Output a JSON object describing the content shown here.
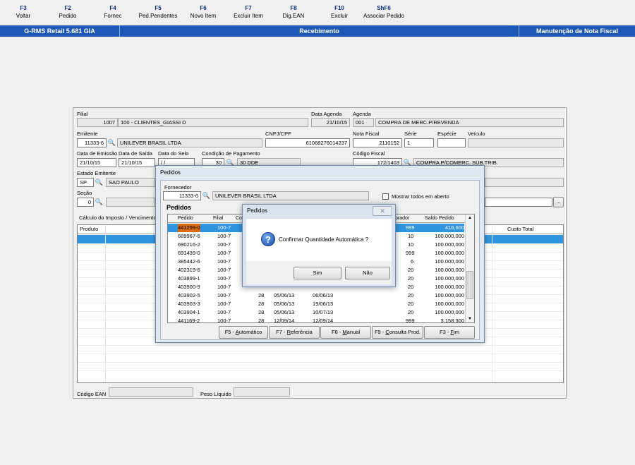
{
  "fkeys": [
    {
      "key": "F3",
      "label": "Voltar"
    },
    {
      "key": "F2",
      "label": "Pedido"
    },
    {
      "key": "F4",
      "label": "Fornec"
    },
    {
      "key": "F5",
      "label": "Ped.Pendentes"
    },
    {
      "key": "F6",
      "label": "Novo Item"
    },
    {
      "key": "F7",
      "label": "Excluir Item"
    },
    {
      "key": "F8",
      "label": "Dig.EAN"
    },
    {
      "key": "F10",
      "label": "Excluir"
    },
    {
      "key": "ShF6",
      "label": "Associar Pedido"
    }
  ],
  "titlebar": {
    "app": "G-RMS Retail 5.681 GIA",
    "center": "Recebimento",
    "right": "Manutenção de Nota Fiscal"
  },
  "form": {
    "filial_label": "Filial",
    "filial_code": "1007",
    "filial_name": "100 - CLIENTES_GIASSI D",
    "data_agenda_label": "Data Agenda",
    "data_agenda": "21/10/15",
    "agenda_label": "Agenda",
    "agenda_code": "001",
    "agenda_desc": "COMPRA DE MERC.P/REVENDA",
    "emitente_label": "Emitente",
    "emitente_code": "11333-6",
    "emitente_name": "UNILEVER BRASIL LTDA",
    "cnpj_label": "CNPJ/CPF",
    "cnpj": "61068276014237",
    "nota_label": "Nota Fiscal",
    "nota": "2110152",
    "serie_label": "Série",
    "serie": "1",
    "especie_label": "Espécie",
    "especie": "",
    "veiculo_label": "Veículo",
    "veiculo": "",
    "data_emissao_label": "Data de Emissão",
    "data_emissao": "21/10/15",
    "data_saida_label": "Data de Saída",
    "data_saida": "21/10/15",
    "data_selo_label": "Data do Selo",
    "data_selo": " /  /",
    "cond_pag_label": "Condição de Pagamento",
    "cond_pag_code": "30",
    "cond_pag_desc": "30 DDE",
    "cod_fiscal_label": "Código Fiscal",
    "cod_fiscal": "172/1403",
    "cod_fiscal_desc": "COMPRA P/COMERC. SUB.TRIB.",
    "estado_label": "Estado Emitente",
    "estado": "SP",
    "estado_name": "SAO PAULO",
    "secao_label": "Seção",
    "secao": "0",
    "ellipsis": "...",
    "calc_label": "Cálculo do Imposto / Vencimento",
    "grid_col_produto": "Produto",
    "grid_col_custo": "Custo Total",
    "ean_label": "Código EAN",
    "peso_label": "Peso Líquido"
  },
  "pedidos_dialog": {
    "title": "Pedidos",
    "fornecedor_label": "Fornecedor",
    "fornecedor_code": "11333-6",
    "fornecedor_name": "UNILEVER BRASIL LTDA",
    "mostrar_label": "Mostrar todos em aberto",
    "section_title": "Pedidos",
    "columns": {
      "pedido": "Pedido",
      "filial": "Filial",
      "co": "Co",
      "comprador": "prador",
      "saldo": "Saldo Pedido"
    },
    "rows": [
      {
        "pedido": "441299-0",
        "filial": "100-7",
        "co": "",
        "d1": "",
        "d2": "",
        "comp": "999",
        "saldo": "416,600"
      },
      {
        "pedido": "689967-6",
        "filial": "100-7",
        "co": "",
        "d1": "",
        "d2": "",
        "comp": "10",
        "saldo": "100.000,000"
      },
      {
        "pedido": "690216-2",
        "filial": "100-7",
        "co": "",
        "d1": "",
        "d2": "",
        "comp": "10",
        "saldo": "100.000,000"
      },
      {
        "pedido": "691439-0",
        "filial": "100-7",
        "co": "",
        "d1": "",
        "d2": "",
        "comp": "999",
        "saldo": "100.000,000"
      },
      {
        "pedido": "385442-6",
        "filial": "100-7",
        "co": "",
        "d1": "",
        "d2": "",
        "comp": "6",
        "saldo": "100.000,000"
      },
      {
        "pedido": "402319-6",
        "filial": "100-7",
        "co": "",
        "d1": "",
        "d2": "",
        "comp": "20",
        "saldo": "100.000,000"
      },
      {
        "pedido": "403899-1",
        "filial": "100-7",
        "co": "",
        "d1": "",
        "d2": "",
        "comp": "20",
        "saldo": "100.000,000"
      },
      {
        "pedido": "403900-9",
        "filial": "100-7",
        "co": "",
        "d1": "",
        "d2": "",
        "comp": "20",
        "saldo": "100.000,000"
      },
      {
        "pedido": "403902-5",
        "filial": "100-7",
        "co": "28",
        "d1": "05/06/13",
        "d2": "06/06/13",
        "comp": "20",
        "saldo": "100.000,000"
      },
      {
        "pedido": "403903-3",
        "filial": "100-7",
        "co": "28",
        "d1": "05/06/13",
        "d2": "19/06/13",
        "comp": "20",
        "saldo": "100.000,000"
      },
      {
        "pedido": "403904-1",
        "filial": "100-7",
        "co": "28",
        "d1": "05/06/13",
        "d2": "10/07/13",
        "comp": "20",
        "saldo": "100.000,000"
      },
      {
        "pedido": "441169-2",
        "filial": "100-7",
        "co": "28",
        "d1": "12/09/14",
        "d2": "12/09/14",
        "comp": "999",
        "saldo": "3.158,300"
      }
    ],
    "buttons": {
      "auto_key": "F5 - ",
      "auto_u": "A",
      "auto_rest": "utomático",
      "ref_key": "F7 - ",
      "ref_u": "R",
      "ref_rest": "eferência",
      "man_key": "F8 - ",
      "man_u": "M",
      "man_rest": "anual",
      "cons_key": "F9 - ",
      "cons_u": "C",
      "cons_rest": "onsulta Prod.",
      "fim_key": "F3 - ",
      "fim_u": "F",
      "fim_rest": "im"
    }
  },
  "confirm_dialog": {
    "title": "Pedidos",
    "message": "Confirmar Quantidade Automática ?",
    "yes": "Sim",
    "no": "Não",
    "close": "✕"
  }
}
